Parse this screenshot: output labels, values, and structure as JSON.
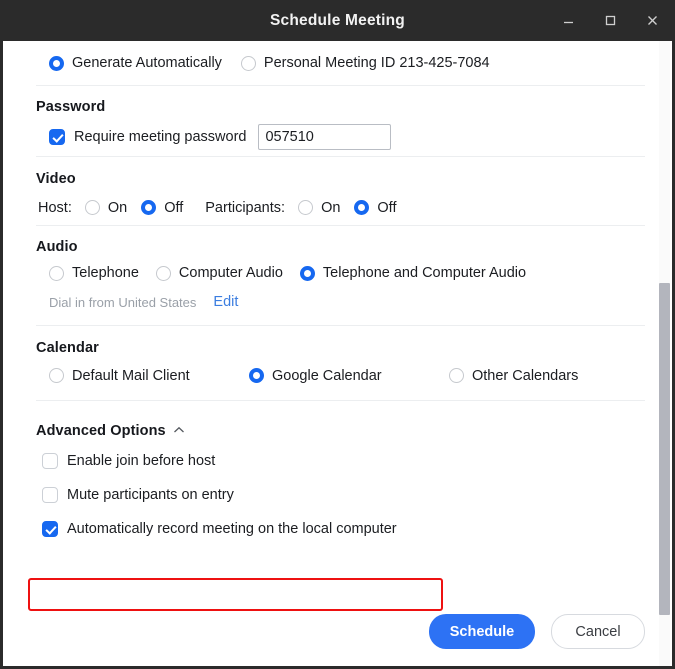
{
  "window": {
    "title": "Schedule Meeting",
    "controls": {
      "minimize": "minimize-icon",
      "maximize": "maximize-icon",
      "close": "close-icon"
    }
  },
  "meeting_id": {
    "options": [
      {
        "label": "Generate Automatically",
        "selected": true
      },
      {
        "label": "Personal Meeting ID 213-425-7084",
        "selected": false
      }
    ]
  },
  "password": {
    "heading": "Password",
    "require_label": "Require meeting password",
    "require_checked": true,
    "value": "057510",
    "placeholder": ""
  },
  "video": {
    "heading": "Video",
    "host_label": "Host:",
    "host_on": "On",
    "host_off": "Off",
    "host_selected": "Off",
    "participants_label": "Participants:",
    "participants_on": "On",
    "participants_off": "Off",
    "participants_selected": "Off"
  },
  "audio": {
    "heading": "Audio",
    "options": [
      {
        "label": "Telephone",
        "selected": false
      },
      {
        "label": "Computer Audio",
        "selected": false
      },
      {
        "label": "Telephone and Computer Audio",
        "selected": true
      }
    ],
    "dial_in_text": "Dial in from United States",
    "edit_link": "Edit"
  },
  "calendar": {
    "heading": "Calendar",
    "options": [
      {
        "label": "Default Mail Client",
        "selected": false
      },
      {
        "label": "Google Calendar",
        "selected": true
      },
      {
        "label": "Other Calendars",
        "selected": false
      }
    ]
  },
  "advanced": {
    "heading": "Advanced Options",
    "chevron": "chevron-up-icon",
    "options": [
      {
        "label": "Enable join before host",
        "checked": false
      },
      {
        "label": "Mute participants on entry",
        "checked": false
      },
      {
        "label": "Automatically record meeting on the local computer",
        "checked": true,
        "highlighted": true
      }
    ]
  },
  "footer": {
    "schedule_label": "Schedule",
    "cancel_label": "Cancel"
  },
  "colors": {
    "accent": "#1668f0",
    "primary_button": "#2d72f4",
    "link": "#3b7de0",
    "highlight": "#ee1111",
    "titlebar": "#2b2b2b"
  }
}
